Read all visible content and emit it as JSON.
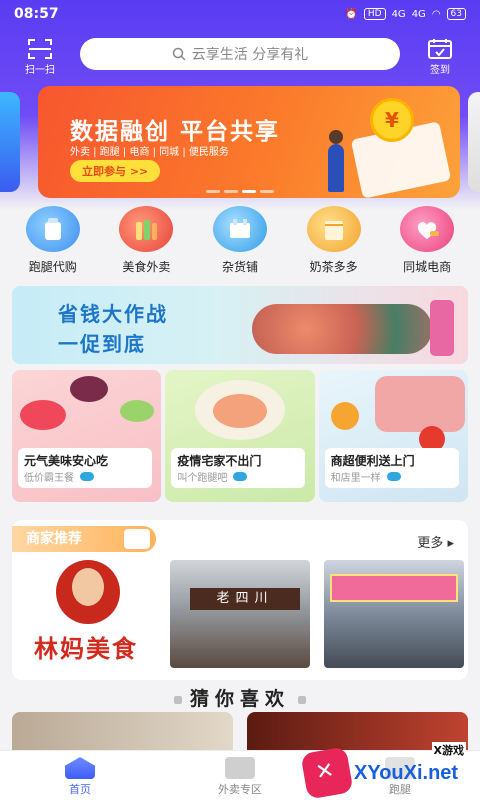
{
  "status_bar": {
    "time": "08:57",
    "network_1": "4G",
    "network_2": "4G",
    "battery": "63"
  },
  "header": {
    "scan_label": "扫一扫",
    "search_placeholder": "云享生活 分享有礼",
    "checkin_label": "签到"
  },
  "banner": {
    "title": "数据融创 平台共享",
    "subtitle": "外卖 | 跑腿 | 电商 | 同城 | 便民服务",
    "cta": "立即参与 >>",
    "coin_symbol": "¥",
    "dots_count": 4,
    "active_dot": 3
  },
  "categories": [
    {
      "label": "跑腿代购",
      "icon": "cup-bag-icon",
      "color": "#4da8f0"
    },
    {
      "label": "美食外卖",
      "icon": "burger-icon",
      "color": "#f25a4a"
    },
    {
      "label": "杂货铺",
      "icon": "shopping-cart-icon",
      "color": "#39a9f0"
    },
    {
      "label": "奶茶多多",
      "icon": "milk-tea-icon",
      "color": "#f5b43a"
    },
    {
      "label": "同城电商",
      "icon": "heart-hand-icon",
      "color": "#f0508a"
    }
  ],
  "promo": {
    "line1": "省钱大作战",
    "line2": "一促到底"
  },
  "feature_cards": [
    {
      "title": "元气美味安心吃",
      "subtitle": "低价霸王餐"
    },
    {
      "title": "疫情宅家不出门",
      "subtitle": "叫个跑腿吧"
    },
    {
      "title": "商超便利送上门",
      "subtitle": "和店里一样"
    }
  ],
  "merchant": {
    "section_title": "商家推荐",
    "more": "更多 ▸",
    "shops": [
      {
        "brand": "林妈美食",
        "badge": "林妈"
      },
      {
        "sign": "老四川"
      },
      {
        "sign": ""
      }
    ]
  },
  "guess": {
    "title": "猜你喜欢"
  },
  "tabbar": [
    {
      "label": "首页"
    },
    {
      "label": "外卖专区"
    },
    {
      "label": "跑腿"
    }
  ],
  "watermark": {
    "small": "X游戏",
    "big": "XYouXi.net"
  },
  "colors": {
    "accent": "#5a3cf2",
    "banner": "#f7562e",
    "tab_active": "#4f6bf0"
  }
}
